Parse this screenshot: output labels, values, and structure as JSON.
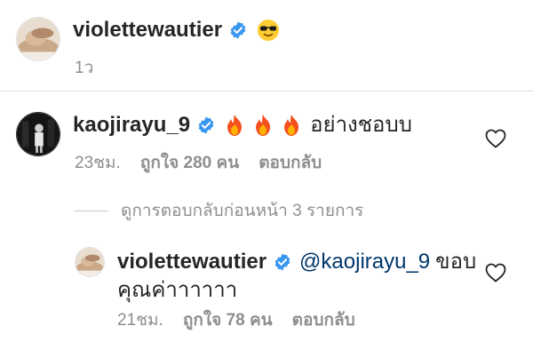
{
  "post_caption": {
    "username": "violettewautier",
    "emoji": "😎",
    "time": "1ว"
  },
  "comment": {
    "username": "kaojirayu_9",
    "emojis": [
      "🔥",
      "🔥",
      "🔥"
    ],
    "text": "อย่างชอบบ",
    "time": "23ชม.",
    "likes": "ถูกใจ 280 คน",
    "reply_label": "ตอบกลับ"
  },
  "view_replies": {
    "label": "ดูการตอบกลับก่อนหน้า 3 รายการ"
  },
  "reply": {
    "username": "violettewautier",
    "mention": "@kaojirayu_9",
    "text_line1": "ขอบ",
    "text_line2": "คุณค่าาาาาา",
    "time": "21ชม.",
    "likes": "ถูกใจ 78 คน",
    "reply_label": "ตอบกลับ"
  },
  "colors": {
    "verified_blue": "#3897f0",
    "meta_gray": "#8e8e8e",
    "mention_blue": "#00376b",
    "divider": "#dbdbdb"
  },
  "icons": {
    "verified": "verified-badge-icon",
    "like": "heart-outline-icon"
  }
}
